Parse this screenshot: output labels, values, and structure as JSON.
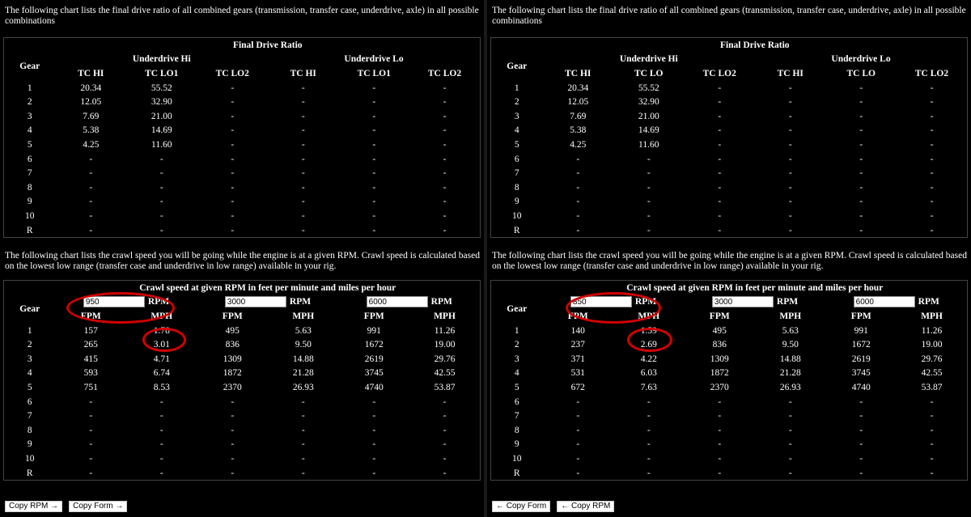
{
  "text": {
    "final_intro": "The following chart lists the final drive ratio of all combined gears (transmission, transfer case, underdrive, axle) in all possible combinations",
    "crawl_intro": "The following chart lists the crawl speed you will be going while the engine is at a given RPM. Crawl speed is calculated based on the lowest low range (transfer case and underdrive in low range) available in your rig.",
    "final_title": "Final Drive Ratio",
    "crawl_title": "Crawl speed at given RPM in feet per minute and miles per hour",
    "gear": "Gear",
    "ud_hi": "Underdrive Hi",
    "ud_lo": "Underdrive Lo",
    "rpm": "RPM",
    "fpm": "FPM",
    "mph": "MPH"
  },
  "accent_ring_color": "#d40000",
  "gears": [
    "1",
    "2",
    "3",
    "4",
    "5",
    "6",
    "7",
    "8",
    "9",
    "10",
    "R"
  ],
  "left": {
    "ratio_cols": [
      "TC HI",
      "TC LO1",
      "TC LO2",
      "TC HI",
      "TC LO1",
      "TC LO2"
    ],
    "ratio_rows": [
      [
        "20.34",
        "55.52",
        "-",
        "-",
        "-",
        "-"
      ],
      [
        "12.05",
        "32.90",
        "-",
        "-",
        "-",
        "-"
      ],
      [
        "7.69",
        "21.00",
        "-",
        "-",
        "-",
        "-"
      ],
      [
        "5.38",
        "14.69",
        "-",
        "-",
        "-",
        "-"
      ],
      [
        "4.25",
        "11.60",
        "-",
        "-",
        "-",
        "-"
      ],
      [
        "-",
        "-",
        "-",
        "-",
        "-",
        "-"
      ],
      [
        "-",
        "-",
        "-",
        "-",
        "-",
        "-"
      ],
      [
        "-",
        "-",
        "-",
        "-",
        "-",
        "-"
      ],
      [
        "-",
        "-",
        "-",
        "-",
        "-",
        "-"
      ],
      [
        "-",
        "-",
        "-",
        "-",
        "-",
        "-"
      ],
      [
        "-",
        "-",
        "-",
        "-",
        "-",
        "-"
      ]
    ],
    "rpms": [
      "950",
      "3000",
      "6000"
    ],
    "crawl_rows": [
      [
        "157",
        "1.78",
        "495",
        "5.63",
        "991",
        "11.26"
      ],
      [
        "265",
        "3.01",
        "836",
        "9.50",
        "1672",
        "19.00"
      ],
      [
        "415",
        "4.71",
        "1309",
        "14.88",
        "2619",
        "29.76"
      ],
      [
        "593",
        "6.74",
        "1872",
        "21.28",
        "3745",
        "42.55"
      ],
      [
        "751",
        "8.53",
        "2370",
        "26.93",
        "4740",
        "53.87"
      ],
      [
        "-",
        "-",
        "-",
        "-",
        "-",
        "-"
      ],
      [
        "-",
        "-",
        "-",
        "-",
        "-",
        "-"
      ],
      [
        "-",
        "-",
        "-",
        "-",
        "-",
        "-"
      ],
      [
        "-",
        "-",
        "-",
        "-",
        "-",
        "-"
      ],
      [
        "-",
        "-",
        "-",
        "-",
        "-",
        "-"
      ],
      [
        "-",
        "-",
        "-",
        "-",
        "-",
        "-"
      ]
    ],
    "buttons": [
      "Copy RPM →",
      "Copy Form →"
    ]
  },
  "right": {
    "ratio_cols": [
      "TC HI",
      "TC LO",
      "TC LO2",
      "TC HI",
      "TC LO",
      "TC LO2"
    ],
    "ratio_rows": [
      [
        "20.34",
        "55.52",
        "-",
        "-",
        "-",
        "-"
      ],
      [
        "12.05",
        "32.90",
        "-",
        "-",
        "-",
        "-"
      ],
      [
        "7.69",
        "21.00",
        "-",
        "-",
        "-",
        "-"
      ],
      [
        "5.38",
        "14.69",
        "-",
        "-",
        "-",
        "-"
      ],
      [
        "4.25",
        "11.60",
        "-",
        "-",
        "-",
        "-"
      ],
      [
        "-",
        "-",
        "-",
        "-",
        "-",
        "-"
      ],
      [
        "-",
        "-",
        "-",
        "-",
        "-",
        "-"
      ],
      [
        "-",
        "-",
        "-",
        "-",
        "-",
        "-"
      ],
      [
        "-",
        "-",
        "-",
        "-",
        "-",
        "-"
      ],
      [
        "-",
        "-",
        "-",
        "-",
        "-",
        "-"
      ],
      [
        "-",
        "-",
        "-",
        "-",
        "-",
        "-"
      ]
    ],
    "rpms": [
      "850",
      "3000",
      "6000"
    ],
    "crawl_rows": [
      [
        "140",
        "1.59",
        "495",
        "5.63",
        "991",
        "11.26"
      ],
      [
        "237",
        "2.69",
        "836",
        "9.50",
        "1672",
        "19.00"
      ],
      [
        "371",
        "4.22",
        "1309",
        "14.88",
        "2619",
        "29.76"
      ],
      [
        "531",
        "6.03",
        "1872",
        "21.28",
        "3745",
        "42.55"
      ],
      [
        "672",
        "7.63",
        "2370",
        "26.93",
        "4740",
        "53.87"
      ],
      [
        "-",
        "-",
        "-",
        "-",
        "-",
        "-"
      ],
      [
        "-",
        "-",
        "-",
        "-",
        "-",
        "-"
      ],
      [
        "-",
        "-",
        "-",
        "-",
        "-",
        "-"
      ],
      [
        "-",
        "-",
        "-",
        "-",
        "-",
        "-"
      ],
      [
        "-",
        "-",
        "-",
        "-",
        "-",
        "-"
      ],
      [
        "-",
        "-",
        "-",
        "-",
        "-",
        "-"
      ]
    ],
    "buttons": [
      "← Copy Form",
      "← Copy RPM"
    ]
  }
}
